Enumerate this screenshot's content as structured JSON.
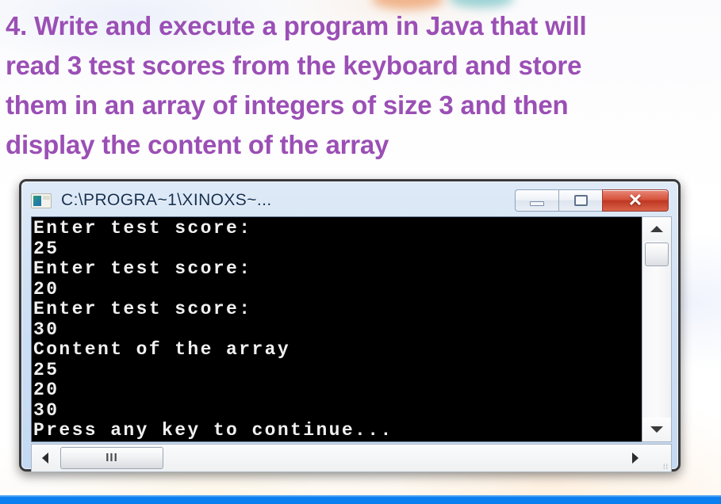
{
  "heading": {
    "text": "4. Write and execute a program in Java that will read 3 test scores from the keyboard and store them in an array of integers of size 3 and then display the content of the array"
  },
  "window": {
    "title": "C:\\PROGRA~1\\XINOXS~...",
    "icon": "console-icon",
    "controls": {
      "minimize_label": "—",
      "maximize_label": "",
      "close_label": "✕"
    }
  },
  "console": {
    "lines": [
      "Enter test score:",
      "25",
      "Enter test score:",
      "20",
      "Enter test score:",
      "30",
      "Content of the array",
      "25",
      "20",
      "30",
      "Press any key to continue..."
    ],
    "text": "Enter test score:\n25\nEnter test score:\n20\nEnter test score:\n30\nContent of the array\n25\n20\n30\nPress any key to continue...",
    "background_color": "#000000",
    "text_color": "#f0f0f0"
  },
  "scrollbars": {
    "vertical": {
      "up_arrow": "▲",
      "down_arrow": "▼"
    },
    "horizontal": {
      "left_arrow": "◀",
      "right_arrow": "▶",
      "grip": "III"
    },
    "resize_grip": "⋰"
  },
  "colors": {
    "heading_purple": "#9B4FB5",
    "title_bar_blue": "#cfe0f4",
    "close_button_red": "#bf3722",
    "bottom_band_blue": "#0a7ff0"
  }
}
